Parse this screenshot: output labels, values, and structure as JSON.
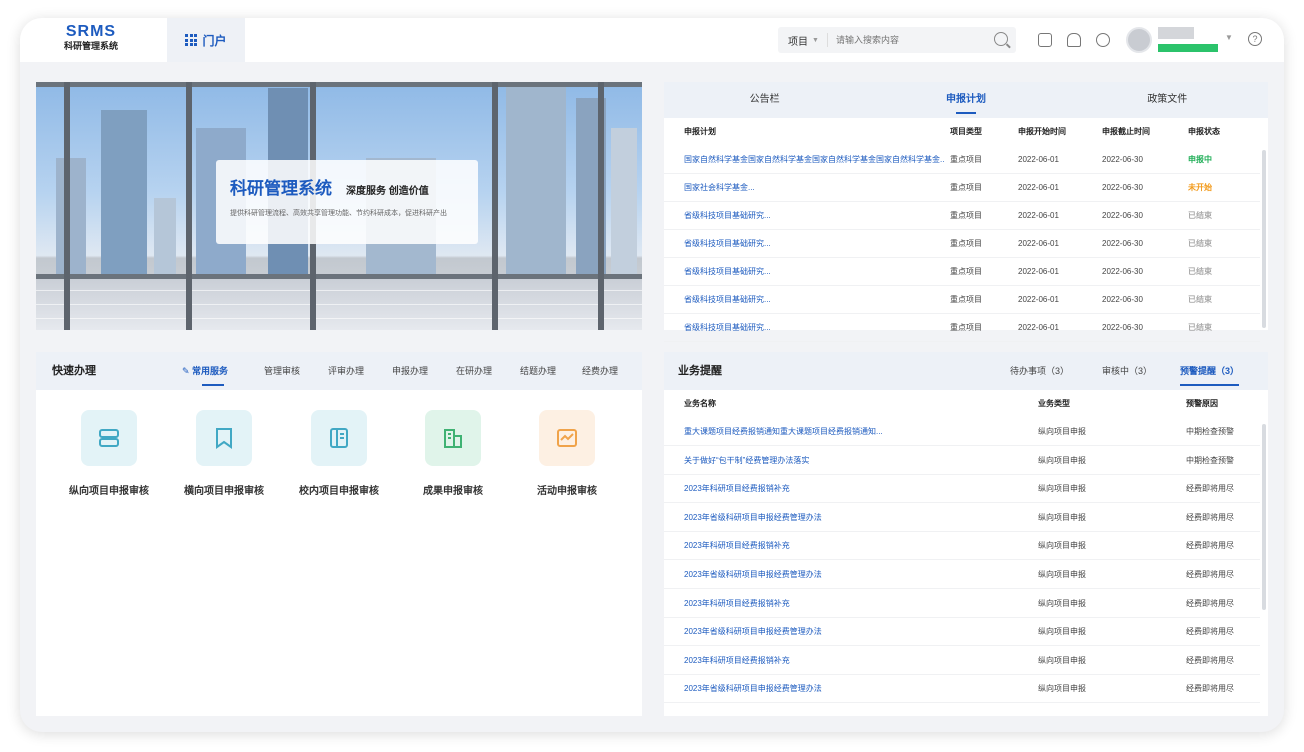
{
  "header": {
    "logo_main": "SRMS",
    "logo_sub": "科研管理系统",
    "portal_tab": "门户",
    "search_scope": "项目",
    "search_placeholder": "请输入搜索内容"
  },
  "banner": {
    "title": "科研管理系统",
    "slogan": "深度服务 创造价值",
    "description": "提供科研管理流程、高效共享管理功能、节约科研成本，促进科研产出"
  },
  "notice": {
    "tabs": [
      "公告栏",
      "申报计划",
      "政策文件"
    ],
    "active_tab": 1,
    "columns": [
      "申报计划",
      "项目类型",
      "申报开始时间",
      "申报截止时间",
      "申报状态"
    ],
    "rows": [
      {
        "name": "国家自然科学基金国家自然科学基金国家自然科学基金国家自然科学基金...",
        "type": "重点项目",
        "start": "2022-06-01",
        "end": "2022-06-30",
        "status": "申报中",
        "status_color": "#1fae57"
      },
      {
        "name": "国家社会科学基金...",
        "type": "重点项目",
        "start": "2022-06-01",
        "end": "2022-06-30",
        "status": "未开始",
        "status_color": "#f29b1d"
      },
      {
        "name": "省级科技项目基础研究...",
        "type": "重点项目",
        "start": "2022-06-01",
        "end": "2022-06-30",
        "status": "已结束",
        "status_color": "#aaaaaa"
      },
      {
        "name": "省级科技项目基础研究...",
        "type": "重点项目",
        "start": "2022-06-01",
        "end": "2022-06-30",
        "status": "已结束",
        "status_color": "#aaaaaa"
      },
      {
        "name": "省级科技项目基础研究...",
        "type": "重点项目",
        "start": "2022-06-01",
        "end": "2022-06-30",
        "status": "已结束",
        "status_color": "#aaaaaa"
      },
      {
        "name": "省级科技项目基础研究...",
        "type": "重点项目",
        "start": "2022-06-01",
        "end": "2022-06-30",
        "status": "已结束",
        "status_color": "#aaaaaa"
      },
      {
        "name": "省级科技项目基础研究...",
        "type": "重点项目",
        "start": "2022-06-01",
        "end": "2022-06-30",
        "status": "已结束",
        "status_color": "#aaaaaa"
      }
    ]
  },
  "quick": {
    "title": "快速办理",
    "tabs": [
      "常用服务",
      "管理审核",
      "评审办理",
      "申报办理",
      "在研办理",
      "结题办理",
      "经费办理"
    ],
    "active_tab": 0,
    "services": [
      {
        "label": "纵向项目申报审核",
        "icon": "server-icon",
        "bg": "#e3f3f7",
        "fg": "#41a8c4"
      },
      {
        "label": "横向项目申报审核",
        "icon": "bookmark-icon",
        "bg": "#e3f3f7",
        "fg": "#41a8c4"
      },
      {
        "label": "校内项目申报审核",
        "icon": "document-icon",
        "bg": "#e3f3f7",
        "fg": "#41a8c4"
      },
      {
        "label": "成果申报审核",
        "icon": "building-icon",
        "bg": "#e0f4ea",
        "fg": "#3fb273"
      },
      {
        "label": "活动申报审核",
        "icon": "chart-icon",
        "bg": "#fdf0e3",
        "fg": "#f0a34a"
      }
    ]
  },
  "business": {
    "title": "业务提醒",
    "tabs": [
      "待办事项（3）",
      "审核中（3）",
      "预警提醒（3）"
    ],
    "active_tab": 2,
    "columns": [
      "业务名称",
      "业务类型",
      "预警原因"
    ],
    "rows": [
      {
        "name": "重大课题项目经费报销通知重大课题项目经费报销通知...",
        "type": "纵向项目申报",
        "reason": "中期检查预警"
      },
      {
        "name": "关于做好“包干制”经费管理办法落实",
        "type": "纵向项目申报",
        "reason": "中期检查预警"
      },
      {
        "name": "2023年科研项目经费报销补充",
        "type": "纵向项目申报",
        "reason": "经费即将用尽"
      },
      {
        "name": "2023年省级科研项目申报经费管理办法",
        "type": "纵向项目申报",
        "reason": "经费即将用尽"
      },
      {
        "name": "2023年科研项目经费报销补充",
        "type": "纵向项目申报",
        "reason": "经费即将用尽"
      },
      {
        "name": "2023年省级科研项目申报经费管理办法",
        "type": "纵向项目申报",
        "reason": "经费即将用尽"
      },
      {
        "name": "2023年科研项目经费报销补充",
        "type": "纵向项目申报",
        "reason": "经费即将用尽"
      },
      {
        "name": "2023年省级科研项目申报经费管理办法",
        "type": "纵向项目申报",
        "reason": "经费即将用尽"
      },
      {
        "name": "2023年科研项目经费报销补充",
        "type": "纵向项目申报",
        "reason": "经费即将用尽"
      },
      {
        "name": "2023年省级科研项目申报经费管理办法",
        "type": "纵向项目申报",
        "reason": "经费即将用尽"
      }
    ]
  },
  "colors": {
    "accent": "#1d5bbf",
    "status_bar": "#2bc36b"
  }
}
